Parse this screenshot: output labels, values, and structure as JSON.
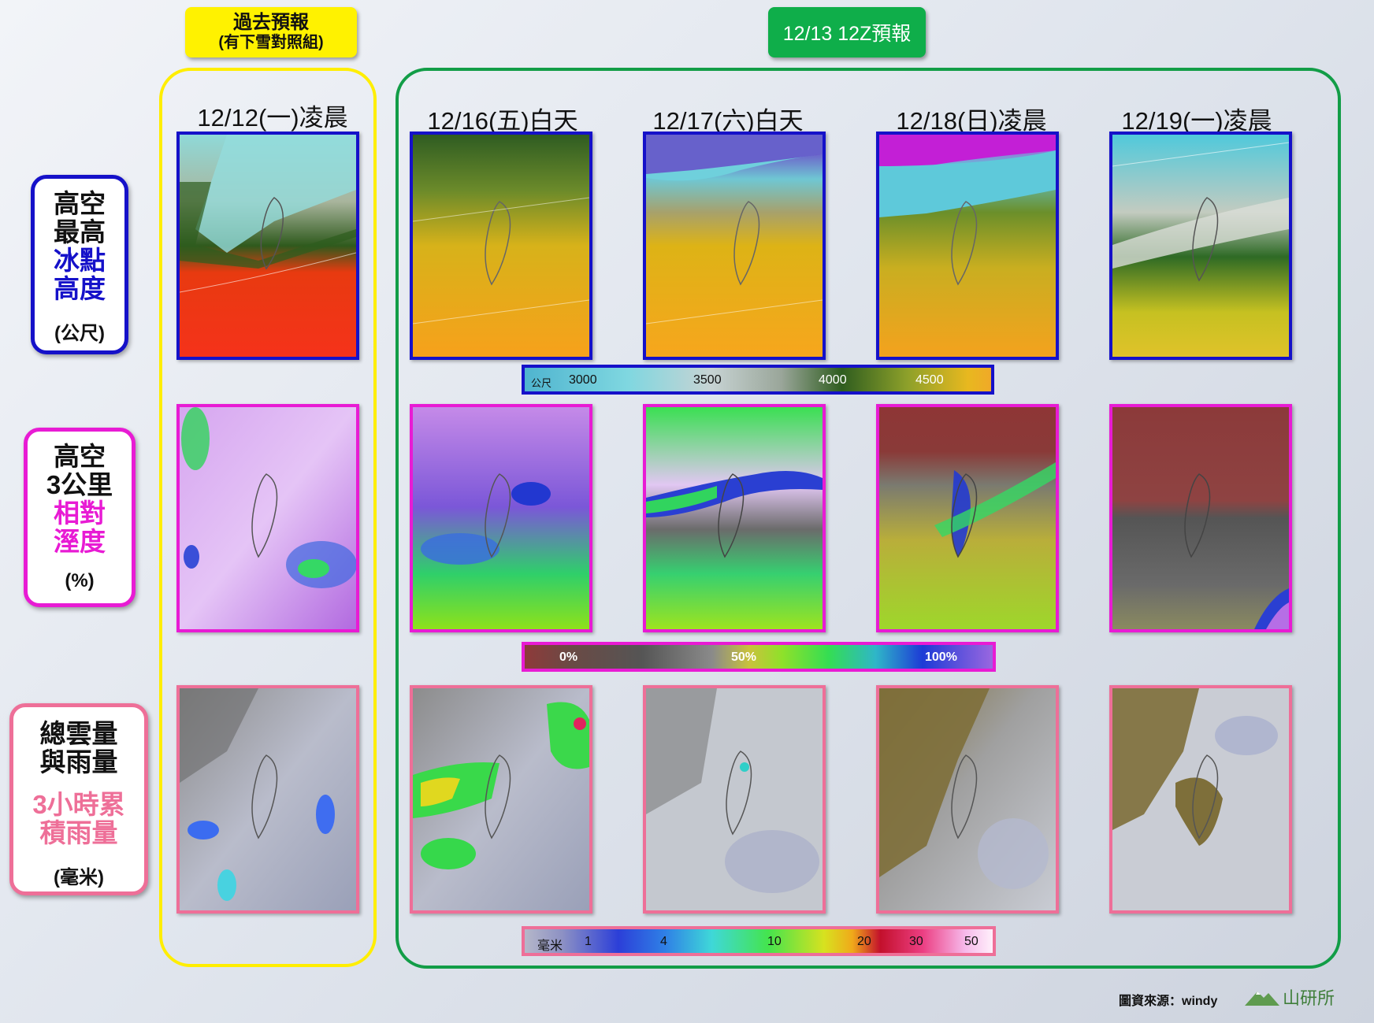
{
  "header": {
    "past_title": "過去預報",
    "past_subtitle": "(有下雪對照組)",
    "forecast_title": "12/13 12Z預報"
  },
  "dates": [
    {
      "label": "12/12(一)凌晨"
    },
    {
      "label": "12/16(五)白天"
    },
    {
      "label": "12/17(六)白天"
    },
    {
      "label": "12/18(日)凌晨"
    },
    {
      "label": "12/19(一)凌晨"
    }
  ],
  "rows": {
    "freezing": {
      "lines": [
        "高空",
        "最高"
      ],
      "highlight": [
        "冰點",
        "高度"
      ],
      "unit": "(公尺)",
      "accent": "#1511c9"
    },
    "humidity": {
      "lines": [
        "高空",
        "3公里"
      ],
      "highlight": [
        "相對",
        "溼度"
      ],
      "unit": "(%)",
      "accent": "#e81bd4"
    },
    "cloud": {
      "lines": [
        "總雲量",
        "與雨量"
      ],
      "highlight": [
        "3小時累",
        "積雨量"
      ],
      "unit": "(毫米)",
      "accent": "#ee6f98"
    }
  },
  "legends": {
    "freezing": {
      "unit": "公尺",
      "ticks": [
        "3000",
        "3500",
        "4000",
        "4500"
      ]
    },
    "humidity": {
      "ticks": [
        "0%",
        "50%",
        "100%"
      ]
    },
    "rain": {
      "unit": "毫米",
      "ticks": [
        "1",
        "4",
        "10",
        "20",
        "30",
        "50"
      ]
    }
  },
  "colors": {
    "blue": "#1511c9",
    "magenta": "#e81bd4",
    "pink": "#ee6f98",
    "yellow": "#fff200",
    "green": "#0fae4a"
  },
  "footer": {
    "source": "圖資來源：windy",
    "logo_text": "山研所"
  }
}
